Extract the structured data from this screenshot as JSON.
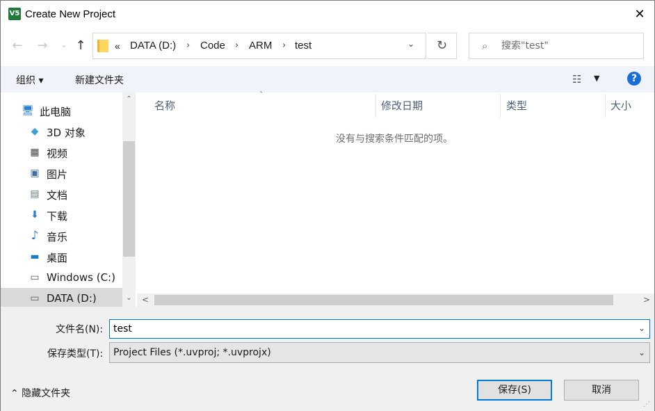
{
  "window": {
    "title": "Create New Project",
    "app_icon_text": "V5",
    "close_glyph": "✕"
  },
  "nav": {
    "back_glyph": "←",
    "forward_glyph": "→",
    "history_glyph": "⌄",
    "up_glyph": "↑"
  },
  "address": {
    "overflow": "«",
    "crumbs": [
      "DATA (D:)",
      "Code",
      "ARM",
      "test"
    ],
    "separator": "›",
    "dropdown_glyph": "⌄",
    "refresh_glyph": "↻"
  },
  "search": {
    "placeholder": "搜索\"test\"",
    "icon_glyph": "⌕"
  },
  "toolbar": {
    "organize_label": "组织 ▾",
    "new_folder_label": "新建文件夹",
    "view_glyph": "☷",
    "view_dd_glyph": "▼",
    "help_glyph": "?"
  },
  "sidebar": {
    "items": [
      {
        "label": "此电脑",
        "icon": "computer-icon",
        "glyph": "🖥"
      },
      {
        "label": "3D 对象",
        "icon": "cube-icon",
        "glyph": "◆"
      },
      {
        "label": "视频",
        "icon": "film-icon",
        "glyph": "▦"
      },
      {
        "label": "图片",
        "icon": "picture-icon",
        "glyph": "▣"
      },
      {
        "label": "文档",
        "icon": "document-icon",
        "glyph": "▤"
      },
      {
        "label": "下载",
        "icon": "download-icon",
        "glyph": "⬇"
      },
      {
        "label": "音乐",
        "icon": "music-icon",
        "glyph": "♪"
      },
      {
        "label": "桌面",
        "icon": "desktop-icon",
        "glyph": "▬"
      },
      {
        "label": "Windows (C:)",
        "icon": "drive-c-icon",
        "glyph": "▭"
      },
      {
        "label": "DATA (D:)",
        "icon": "drive-d-icon",
        "glyph": "▭"
      }
    ],
    "scroll_up_glyph": "⌃",
    "scroll_down_glyph": "⌄"
  },
  "file_list": {
    "columns": [
      "名称",
      "修改日期",
      "类型",
      "大小"
    ],
    "sort_glyph": "˄",
    "empty_message": "没有与搜索条件匹配的项。",
    "scroll_left_glyph": "<",
    "scroll_right_glyph": ">"
  },
  "form": {
    "filename_label": "文件名(N):",
    "filename_value": "test",
    "filetype_label": "保存类型(T):",
    "filetype_value": "Project Files (*.uvproj; *.uvprojx)",
    "dropdown_glyph": "⌄"
  },
  "footer": {
    "hide_folders_label": "⌃  隐藏文件夹",
    "save_label": "保存(S)",
    "cancel_label": "取消"
  },
  "colors": {
    "accent": "#0078d7",
    "help_blue": "#1a6ed8",
    "toolbar_bg": "#f0f3f9",
    "selected_bg": "#d9d9d9"
  }
}
